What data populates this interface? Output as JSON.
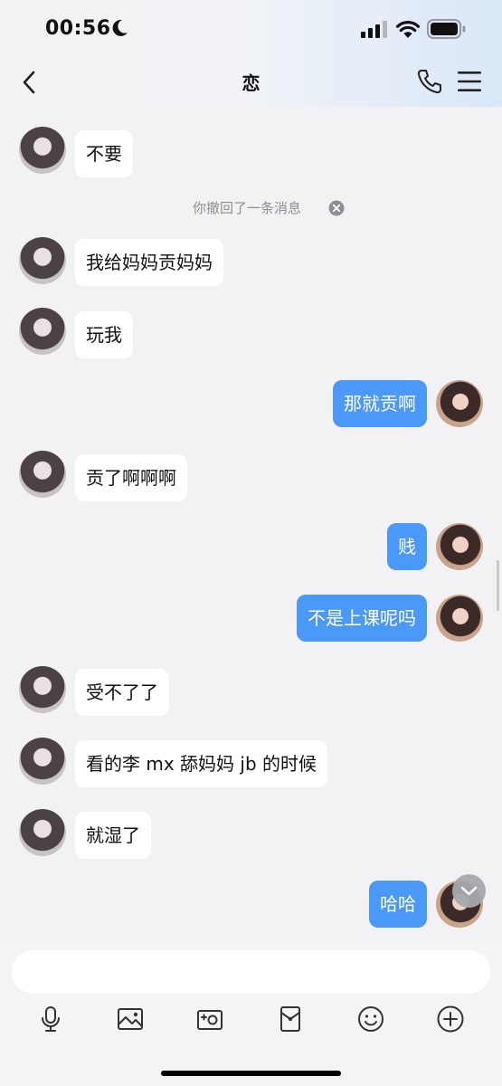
{
  "status": {
    "time": "00:56"
  },
  "header": {
    "title": "恋"
  },
  "messages": [
    {
      "side": "left",
      "text": "不要"
    },
    {
      "side": "left",
      "text": "我给妈妈贡妈妈"
    },
    {
      "side": "left",
      "text": "玩我"
    },
    {
      "side": "right",
      "text": "那就贡啊"
    },
    {
      "side": "left",
      "text": "贡了啊啊啊"
    },
    {
      "side": "right",
      "text": "贱"
    },
    {
      "side": "right",
      "text": "不是上课呢吗"
    },
    {
      "side": "left",
      "text": "受不了了"
    },
    {
      "side": "left",
      "text": "看的李 mx 舔妈妈 jb 的时候"
    },
    {
      "side": "left",
      "text": "就湿了"
    },
    {
      "side": "right",
      "text": "哈哈"
    }
  ],
  "notice": {
    "text": "你撤回了一条消息"
  },
  "input": {
    "placeholder": ""
  },
  "toolbar": [
    "microphone-icon",
    "image-icon",
    "camera-icon",
    "red-packet-icon",
    "emoji-icon",
    "plus-icon"
  ],
  "colors": {
    "accent": "#4a98f7",
    "background": "#f2f2f4",
    "bubble_incoming": "#ffffff"
  }
}
